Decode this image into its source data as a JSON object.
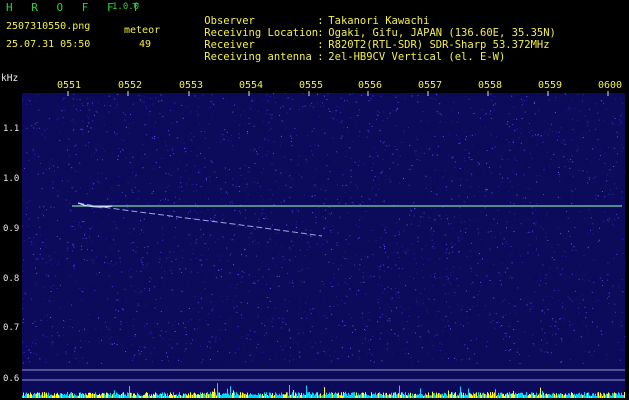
{
  "header": {
    "app_title": "H R O F F T",
    "version": "1.0.0",
    "file_name": "2507310550.png",
    "datetime": "25.07.31 05:50",
    "meteor_label": "meteor",
    "meteor_count": "49"
  },
  "station_info": [
    {
      "key": "Observer",
      "sep": ":",
      "value": "Takanori Kawachi"
    },
    {
      "key": "Receiving Location",
      "sep": ":",
      "value": "Ogaki, Gifu, JAPAN (136.60E, 35.35N)"
    },
    {
      "key": "Receiver",
      "sep": ":",
      "value": "R820T2(RTL-SDR) SDR-Sharp 53.372MHz"
    },
    {
      "key": "Receiving antenna",
      "sep": ":",
      "value": "2el-HB9CV Vertical (el. E-W)"
    }
  ],
  "axes": {
    "y_unit": "kHz",
    "x_ticks": [
      "0551",
      "0552",
      "0553",
      "0554",
      "0555",
      "0556",
      "0557",
      "0558",
      "0559",
      "0600"
    ],
    "y_ticks": [
      "1.1",
      "1.0",
      "0.9",
      "0.8",
      "0.7",
      "0.6"
    ]
  },
  "colors": {
    "background": "#000000",
    "spectrogram": "#0c0a5a",
    "title_green": "#22d63a",
    "label_yellow": "#f3f04a",
    "signal_line": "#7dd8a8",
    "histogram_cyan": "#00d8ff",
    "histogram_yellow": "#ffff20"
  }
}
